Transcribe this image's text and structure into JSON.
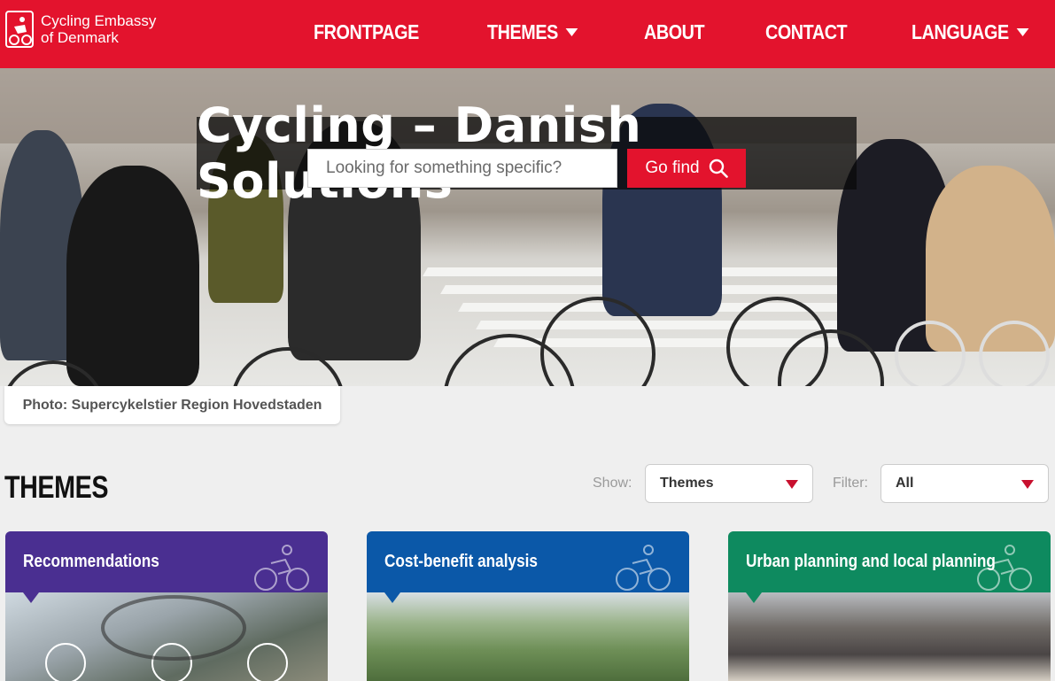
{
  "header": {
    "logo_line1": "Cycling Embassy",
    "logo_line2": "of Denmark",
    "nav": [
      {
        "label": "FRONTPAGE",
        "has_caret": false
      },
      {
        "label": "THEMES",
        "has_caret": true
      },
      {
        "label": "ABOUT",
        "has_caret": false
      },
      {
        "label": "CONTACT",
        "has_caret": false
      },
      {
        "label": "LANGUAGE",
        "has_caret": true
      }
    ],
    "color": "#e3132d"
  },
  "hero": {
    "title": "Cycling – Danish Solutions",
    "search_placeholder": "Looking for something specific?",
    "search_button": "Go find",
    "photo_credit": "Photo: Supercykelstier Region Hovedstaden"
  },
  "themes": {
    "heading": "THEMES",
    "show_label": "Show:",
    "show_value": "Themes",
    "filter_label": "Filter:",
    "filter_value": "All",
    "cards": [
      {
        "title": "Recommendations",
        "color": "#4a2f91"
      },
      {
        "title": "Cost-benefit analysis",
        "color": "#0b58a8"
      },
      {
        "title": "Urban planning and local planning",
        "color": "#0e8a5f"
      }
    ]
  }
}
